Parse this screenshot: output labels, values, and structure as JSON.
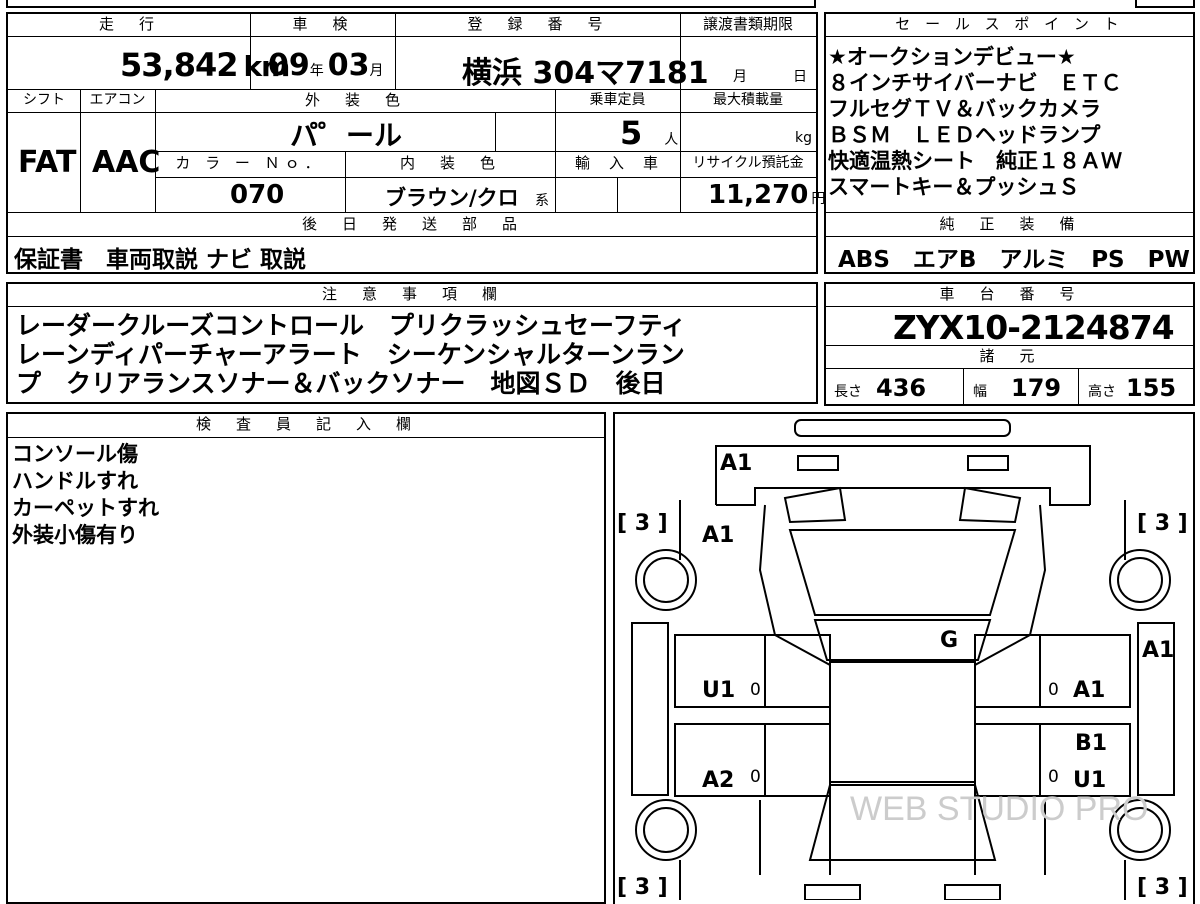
{
  "header": {
    "mileage_label": "走　行",
    "shaken_label": "車　検",
    "registration_label": "登　録　番　号",
    "transfer_deadline_label": "譲渡書類期限",
    "sales_points_label": "セ ー ル ス ポ イ ン ト"
  },
  "mileage": {
    "value": "53,842",
    "unit": "km"
  },
  "shaken": {
    "year": "09",
    "year_unit": "年",
    "month": "03",
    "month_unit": "月"
  },
  "registration": {
    "plate": "横浜 304マ7181"
  },
  "transfer_deadline": {
    "month_unit": "月",
    "day_unit": "日"
  },
  "row2_labels": {
    "shift": "シフト",
    "aircon": "エアコン",
    "exterior_color": "外　装　色",
    "seating": "乗車定員",
    "max_load": "最大積載量"
  },
  "shift": "FAT",
  "aircon": "AAC",
  "exterior_color": "パ゜ール",
  "seating": {
    "value": "5",
    "unit": "人"
  },
  "max_load": {
    "unit": "kg"
  },
  "row3_labels": {
    "color_no": "カ ラ ー Ｎｏ．",
    "interior_color": "内　装　色",
    "import": "輸　入　車",
    "recycle": "リサイクル預託金"
  },
  "color_no": "070",
  "interior_color": {
    "value": "ブラウン/クロ",
    "suffix": "系"
  },
  "recycle": {
    "value": "11,270",
    "unit": "円"
  },
  "later_parts": {
    "label": "後　日　発　送　部　品",
    "value": "保証書　車両取説 ナビ 取説"
  },
  "sales_points": [
    "★オークションデビュー★",
    "８インチサイバーナビ　ＥＴＣ",
    "フルセグＴＶ＆バックカメラ",
    "ＢＳＭ　ＬＥＤヘッドランプ",
    "快適温熱シート　純正１８ＡＷ",
    "スマートキー＆プッシュＳ"
  ],
  "genuine_equipment": {
    "label": "純　正　装　備",
    "value": "ABS　エアB　アルミ　PS　PW"
  },
  "notes": {
    "label": "注　意　事　項　欄",
    "lines": [
      "レーダークルーズコントロール　プリクラッシュセーフティ",
      "レーンディパーチャーアラート　シーケンシャルターンラン",
      "プ　クリアランスソナー＆バックソナー　地図ＳＤ　後日"
    ]
  },
  "chassis": {
    "label": "車　台　番　号",
    "value": "ZYX10-2124874"
  },
  "specs": {
    "label": "諸　元",
    "length_label": "長さ",
    "length": "436",
    "width_label": "幅",
    "width": "179",
    "height_label": "高さ",
    "height": "155"
  },
  "inspector": {
    "label": "検　査　員　記　入　欄",
    "lines": [
      "コンソール傷",
      "ハンドルすれ",
      "カーペットすれ",
      "外装小傷有り"
    ]
  },
  "diagram": {
    "marks": {
      "front_bumper": "A1",
      "hood": "A1",
      "windshield": "G",
      "left_front_door": "U1",
      "left_rear_door": "A2",
      "right_front_fender": "A1",
      "right_front_door": "A1",
      "right_rear_door_1": "B1",
      "right_rear_door_2": "U1"
    },
    "tire_brackets": [
      "[ 3 ]",
      "[ 3 ]",
      "[ 3 ]",
      "[ 3 ]"
    ],
    "zero": "0",
    "watermark": "WEB STUDIO PRO"
  }
}
